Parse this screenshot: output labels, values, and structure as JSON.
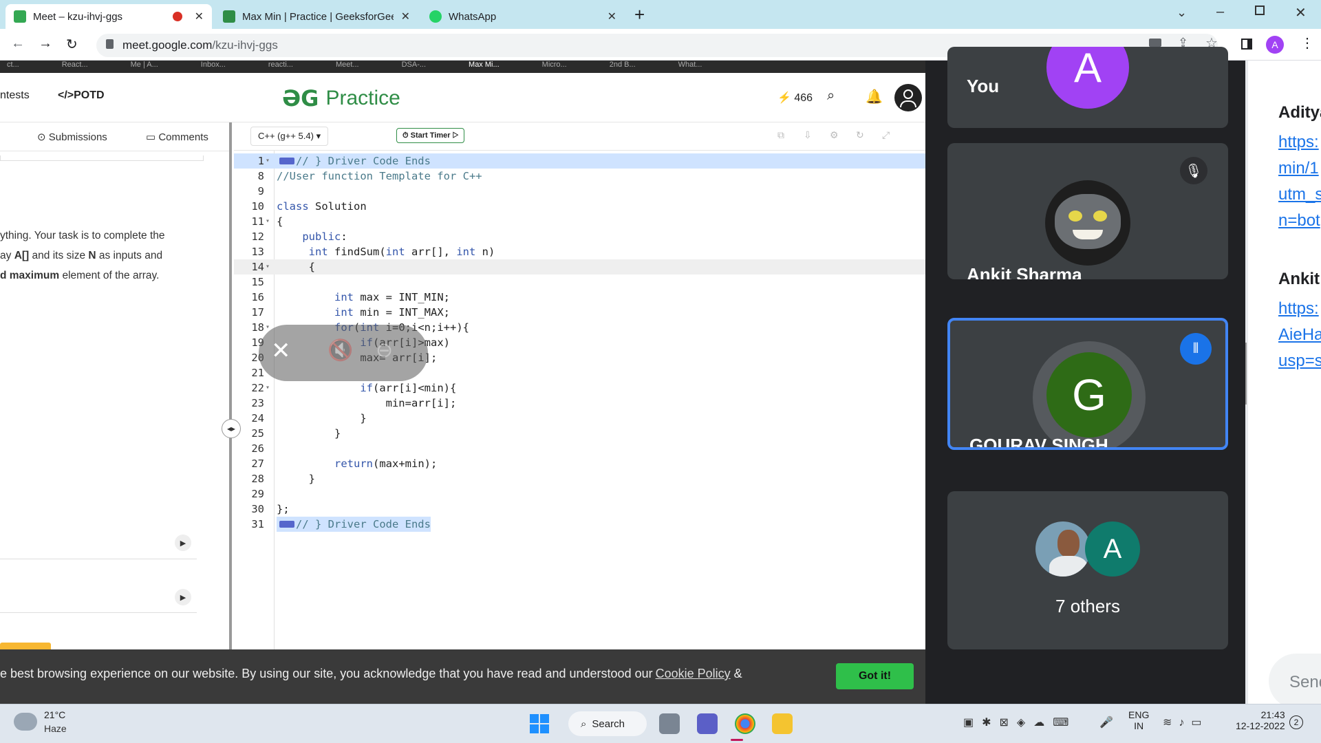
{
  "browser": {
    "tabs": [
      {
        "label": "Meet – kzu-ihvj-ggs",
        "active": true
      },
      {
        "label": "Max Min | Practice | GeeksforGee",
        "active": false
      },
      {
        "label": "WhatsApp",
        "active": false
      }
    ],
    "new_tab": "+",
    "url_host": "meet.google.com",
    "url_path": "/kzu-ihvj-ggs",
    "profile_initial": "A",
    "bookmarks": [
      "ct...",
      "React...",
      "Me | A...",
      "Inbox...",
      "reacti...",
      "Meet...",
      "DSA-...",
      "Max Mi...",
      "Micro...",
      "2nd B...",
      "What..."
    ]
  },
  "gfg": {
    "nav_contests": "ntests",
    "nav_potd": "</>POTD",
    "logo_text": "Practice",
    "streak": "466",
    "tabs": {
      "submissions": "Submissions",
      "comments": "Comments"
    },
    "problem_text": [
      {
        "plain": "ything. Your task is to complete the",
        "bold": ""
      },
      {
        "pre": "ay ",
        "bold": "A[]",
        "post": " and its size ",
        "bold2": "N",
        "post2": " as inputs and"
      },
      {
        "pre": "",
        "bold": "d maximum",
        "post": " element of the array.",
        "bold2": "",
        "post2": ""
      }
    ],
    "language": "C++ (g++ 5.4)",
    "start_timer": "Start Timer",
    "code_lines": [
      {
        "n": "1",
        "fold": true,
        "text": "// } Driver Code Ends",
        "highlight": true
      },
      {
        "n": "8",
        "text": "//User function Template for C++"
      },
      {
        "n": "9",
        "text": ""
      },
      {
        "n": "10",
        "text": "class Solution"
      },
      {
        "n": "11",
        "fold": true,
        "text": "{"
      },
      {
        "n": "12",
        "text": "    public:"
      },
      {
        "n": "13",
        "text": "     int findSum(int arr[], int n)"
      },
      {
        "n": "14",
        "fold": true,
        "text": "     {",
        "active": true
      },
      {
        "n": "15",
        "text": ""
      },
      {
        "n": "16",
        "text": "         int max = INT_MIN;"
      },
      {
        "n": "17",
        "text": "         int min = INT_MAX;"
      },
      {
        "n": "18",
        "fold": true,
        "text": "         for(int i=0;i<n;i++){"
      },
      {
        "n": "19",
        "text": "             if(arr[i]>max)"
      },
      {
        "n": "20",
        "text": "             max= arr[i];"
      },
      {
        "n": "21",
        "text": ""
      },
      {
        "n": "22",
        "fold": true,
        "text": "             if(arr[i]<min){"
      },
      {
        "n": "23",
        "text": "                 min=arr[i];"
      },
      {
        "n": "24",
        "text": "             }"
      },
      {
        "n": "25",
        "text": "         }"
      },
      {
        "n": "26",
        "text": ""
      },
      {
        "n": "27",
        "text": "         return(max+min);"
      },
      {
        "n": "28",
        "text": "     }"
      },
      {
        "n": "29",
        "text": ""
      },
      {
        "n": "30",
        "text": "};"
      },
      {
        "n": "31",
        "text": "// } Driver Code Ends",
        "highlight": true
      }
    ],
    "cookie_text": "e best browsing experience on our website. By using our site, you acknowledge that you have read and understood our",
    "cookie_link": "Cookie Policy",
    "cookie_amp": " &",
    "got_it": "Got it!"
  },
  "meet": {
    "tiles": [
      {
        "name": "You",
        "avatar_initial": "A",
        "avatar_color": "#a142f4"
      },
      {
        "name": "Ankit Sharma",
        "muted": true
      },
      {
        "name": "GOURAV SINGH",
        "avatar_initial": "G",
        "avatar_color": "#2e6b16",
        "speaking": true
      },
      {
        "others_label": "7 others",
        "avatar_initial": "A",
        "avatar_color": "#0f7b6c"
      }
    ],
    "chat": {
      "sender1": "Aditya",
      "link1_lines": [
        "https:",
        "min/1",
        "utm_s",
        "n=bot"
      ],
      "sender2": "Ankit",
      "link2_lines": [
        "https:",
        "AieHa",
        "usp=s"
      ],
      "send_placeholder": "Send"
    }
  },
  "taskbar": {
    "weather_temp": "21°C",
    "weather_desc": "Haze",
    "search_label": "Search",
    "lang_top": "ENG",
    "lang_bottom": "IN",
    "time": "21:43",
    "date": "12-12-2022",
    "notification_count": "2"
  }
}
